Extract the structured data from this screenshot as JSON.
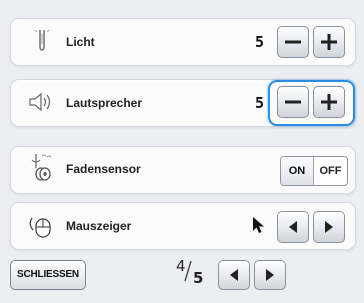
{
  "settings": [
    {
      "label": "Licht",
      "value": "5",
      "icon": "needle-light-icon"
    },
    {
      "label": "Lautsprecher",
      "value": "5",
      "icon": "speaker-icon"
    },
    {
      "label": "Fadensensor",
      "toggle": {
        "on_label": "ON",
        "off_label": "OFF",
        "state": "on"
      },
      "icon": "thread-sensor-icon"
    },
    {
      "label": "Mauszeiger",
      "icon": "mouse-icon",
      "cursor_icon": "arrow-cursor-icon"
    }
  ],
  "footer": {
    "close_label": "SCHLIESSEN",
    "page_current": "4",
    "page_total": "5"
  },
  "colors": {
    "focus": "#2a8de1",
    "panel": "#fbfbfc",
    "background": "#eceef2"
  }
}
